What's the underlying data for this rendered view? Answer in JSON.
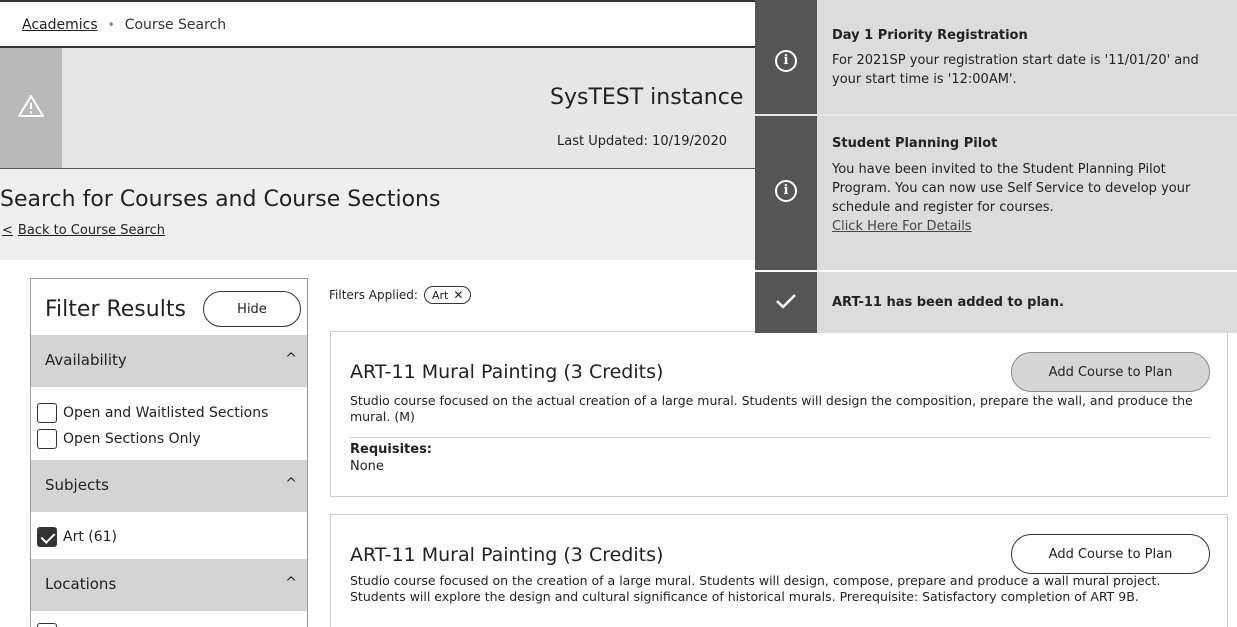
{
  "breadcrumb": {
    "parent": "Academics",
    "separator": "•",
    "current": "Course Search"
  },
  "banner": {
    "title": "SysTEST instance",
    "updated": "Last Updated: 10/19/2020"
  },
  "page": {
    "title": "Search for Courses and Course Sections",
    "back_chevron": "<",
    "back_link": "Back to Course Search"
  },
  "filters": {
    "title": "Filter Results",
    "hide_label": "Hide",
    "sections": [
      {
        "label": "Availability",
        "options": [
          {
            "label": "Open and Waitlisted Sections",
            "checked": false
          },
          {
            "label": "Open Sections Only",
            "checked": false
          }
        ]
      },
      {
        "label": "Subjects",
        "options": [
          {
            "label": "Art (61)",
            "checked": true
          }
        ]
      },
      {
        "label": "Locations",
        "options": []
      }
    ],
    "chevron": "^"
  },
  "applied": {
    "label": "Filters Applied:",
    "pill": "Art",
    "pill_remove": "✕"
  },
  "courses": [
    {
      "title": "ART-11 Mural Painting (3 Credits)",
      "button": "Add Course to Plan",
      "button_state": "added",
      "description": "Studio course focused on the actual creation of a large mural. Students will design the composition, prepare the wall, and produce the mural. (M)",
      "requisites_label": "Requisites:",
      "requisites_value": "None"
    },
    {
      "title": "ART-11 Mural Painting (3 Credits)",
      "button": "Add Course to Plan",
      "button_state": "default",
      "description": "Studio course focused on the creation of a large mural. Students will design, compose, prepare and produce a wall mural project. Students will explore the design and cultural significance of historical murals. Prerequisite: Satisfactory completion of ART 9B."
    }
  ],
  "notifications": [
    {
      "icon": "info-icon",
      "title": "Day 1 Priority Registration",
      "text": "For 2021SP your registration start date is '11/01/20' and your start time is '12:00AM'."
    },
    {
      "icon": "info-icon",
      "title": "Student Planning Pilot",
      "text": "You have been invited to the Student Planning Pilot Program. You can now use Self Service to develop your schedule and register for courses.",
      "link": "Click Here For Details"
    },
    {
      "icon": "checkmark-icon",
      "title": "ART-11 has been added to plan."
    }
  ],
  "colors": {
    "icon_column": "#555555",
    "notification_bg": "#dcdcdc",
    "banner_bg": "#e6e6e6",
    "filter_header_bg": "#d4d4d4"
  }
}
